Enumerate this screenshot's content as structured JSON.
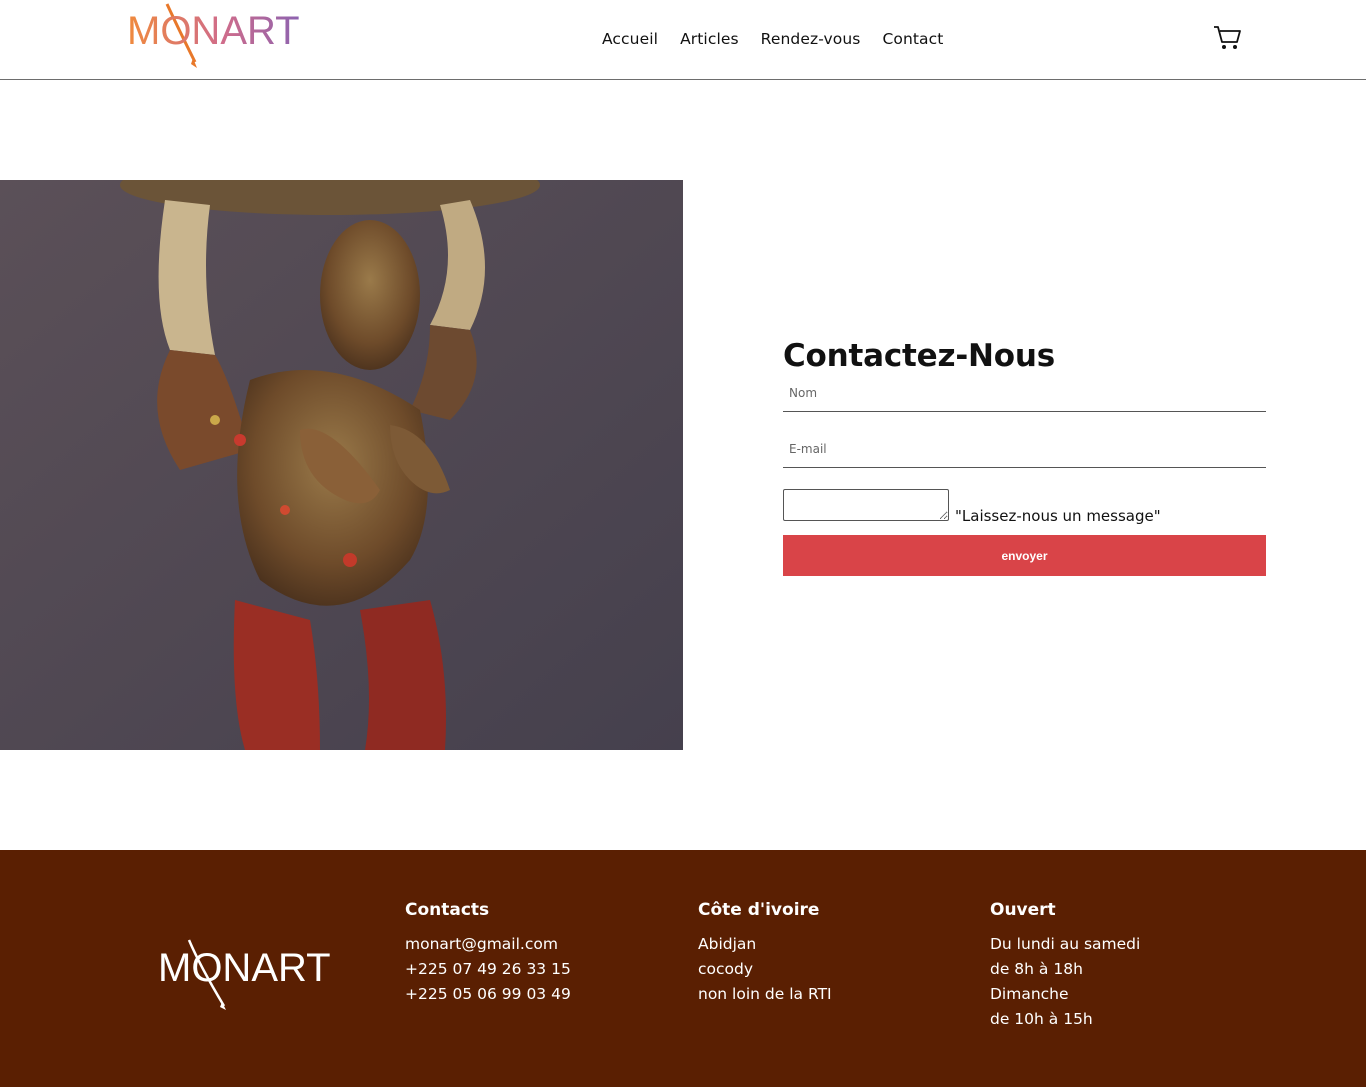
{
  "brand": {
    "logo_text": "MONART",
    "logo_colors": [
      "#f08a3c",
      "#c06bb0",
      "#8c62b0"
    ]
  },
  "nav": [
    {
      "label": "Accueil"
    },
    {
      "label": "Articles"
    },
    {
      "label": "Rendez-vous"
    },
    {
      "label": "Contact"
    }
  ],
  "cart": {
    "icon": "cart-icon"
  },
  "contact": {
    "title": "Contactez-Nous",
    "name_placeholder": "Nom",
    "email_placeholder": "E-mail",
    "message_label": "\"Laissez-nous un message\"",
    "submit_label": "envoyer",
    "submit_color": "#d94448"
  },
  "footer": {
    "background": "#5a1f02",
    "logo_text": "MONART",
    "columns": [
      {
        "title": "Contacts",
        "lines": [
          "monart@gmail.com",
          "+225 07 49 26 33 15",
          "+225 05 06 99 03 49"
        ]
      },
      {
        "title": "Côte d'ivoire",
        "lines": [
          "Abidjan",
          "cocody",
          "non loin de la RTI"
        ]
      },
      {
        "title": "Ouvert",
        "lines": [
          "Du lundi au samedi",
          "de 8h à 18h",
          "Dimanche",
          "de 10h à 15h"
        ]
      }
    ]
  }
}
